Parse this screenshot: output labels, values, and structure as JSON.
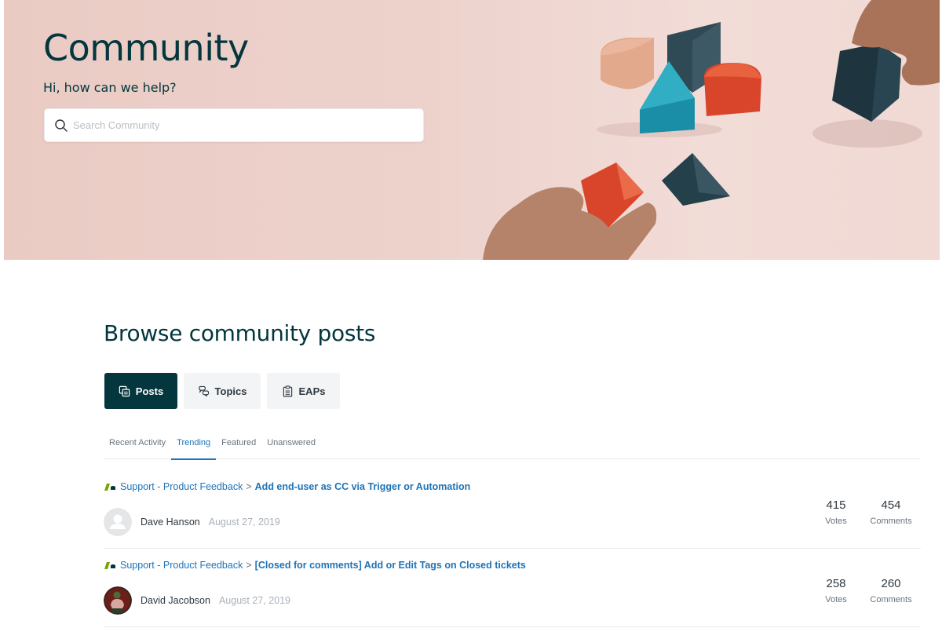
{
  "hero": {
    "title": "Community",
    "subtitle": "Hi, how can we help?",
    "search_placeholder": "Search Community",
    "search_value": ""
  },
  "browse": {
    "title": "Browse community posts",
    "main_tabs": [
      {
        "label": "Posts",
        "icon": "posts-icon",
        "active": true
      },
      {
        "label": "Topics",
        "icon": "topics-icon",
        "active": false
      },
      {
        "label": "EAPs",
        "icon": "clipboard-icon",
        "active": false
      }
    ],
    "sub_tabs": [
      {
        "label": "Recent Activity",
        "active": false
      },
      {
        "label": "Trending",
        "active": true
      },
      {
        "label": "Featured",
        "active": false
      },
      {
        "label": "Unanswered",
        "active": false
      }
    ]
  },
  "posts": [
    {
      "category": "Support - Product Feedback",
      "separator": ">",
      "title": "Add end-user as CC via Trigger or Automation",
      "author": "Dave Hanson",
      "date": "August 27, 2019",
      "avatar": "default",
      "votes": "415",
      "votes_label": "Votes",
      "comments": "454",
      "comments_label": "Comments"
    },
    {
      "category": "Support - Product Feedback",
      "separator": ">",
      "title": "[Closed for comments] Add or Edit Tags on Closed tickets",
      "author": "David Jacobson",
      "date": "August 27, 2019",
      "avatar": "photo",
      "votes": "258",
      "votes_label": "Votes",
      "comments": "260",
      "comments_label": "Comments"
    }
  ],
  "colors": {
    "brand_dark": "#03363d",
    "link_blue": "#1f73b7",
    "hero_bg": "#edd2cc",
    "zendesk_green": "#78a300"
  }
}
